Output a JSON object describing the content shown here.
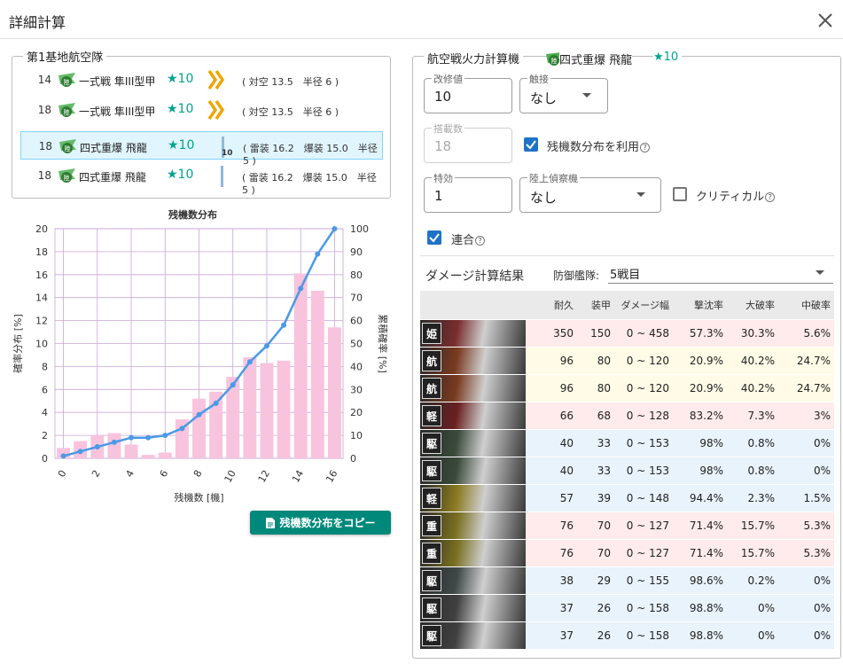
{
  "dialog": {
    "title": "詳細計算",
    "close_icon": "close-icon"
  },
  "air_base": {
    "legend": "第1基地航空隊",
    "slots": [
      {
        "count": "14",
        "name": "一式戦 隼III型甲",
        "star": "★10",
        "proficiency": "chevron",
        "stats": "( 対空 13.5　半径 6 )",
        "selected": false
      },
      {
        "count": "18",
        "name": "一式戦 隼III型甲",
        "star": "★10",
        "proficiency": "chevron",
        "stats": "( 対空 13.5　半径 6 )",
        "selected": false
      },
      {
        "count": "18",
        "name": "四式重爆 飛龍",
        "star": "★10",
        "proficiency": "bar",
        "level": "10",
        "stats": "( 雷装 16.2　爆装 15.0　半径 5 )",
        "selected": true
      },
      {
        "count": "18",
        "name": "四式重爆 飛龍",
        "star": "★10",
        "proficiency": "bar",
        "stats": "( 雷装 16.2　爆装 15.0　半径 5 )",
        "selected": false
      }
    ]
  },
  "chart_data": {
    "type": "bar",
    "title": "残機数分布",
    "xlabel": "残機数 [機]",
    "ylabel": "確率分布 [%]",
    "y2label": "累積確率 [%]",
    "ylim": [
      0,
      20
    ],
    "y2lim": [
      0,
      100
    ],
    "yticks": [
      "0",
      "2",
      "4",
      "6",
      "8",
      "10",
      "12",
      "14",
      "16",
      "18",
      "20"
    ],
    "y2ticks": [
      "0",
      "10",
      "20",
      "30",
      "40",
      "50",
      "60",
      "70",
      "80",
      "90",
      "100"
    ],
    "xticks": [
      "0",
      "2",
      "4",
      "6",
      "8",
      "10",
      "12",
      "14",
      "16"
    ],
    "categories": [
      0,
      1,
      2,
      3,
      4,
      5,
      6,
      7,
      8,
      9,
      10,
      11,
      12,
      13,
      14,
      15,
      16
    ],
    "series": [
      {
        "values": [
          0.9,
          1.5,
          2.0,
          2.2,
          1.2,
          0.3,
          0.5,
          3.4,
          5.2,
          5.8,
          7.1,
          8.8,
          8.3,
          8.5,
          16.1,
          14.6,
          11.4
        ],
        "color": "#f8c3dd"
      },
      {
        "values": [
          1,
          3,
          5,
          7,
          9,
          9,
          10,
          13,
          19,
          24,
          32,
          42,
          49,
          58,
          74,
          89,
          100
        ],
        "color": "#4a9ae6",
        "axis": "right"
      }
    ]
  },
  "copy_button": {
    "label": "残機数分布をコピー",
    "icon": "document-icon"
  },
  "calc": {
    "legend": "航空戦火力計算機",
    "equipment": "四式重爆 飛龍",
    "equipment_star": "★10",
    "fields": {
      "kaishu": {
        "label": "改修値",
        "value": "10"
      },
      "contact": {
        "label": "触接",
        "value": "なし"
      },
      "slots": {
        "label": "搭載数",
        "value": "18"
      },
      "special": {
        "label": "特効",
        "value": "1"
      },
      "recon": {
        "label": "陸上偵察機",
        "value": "なし"
      }
    },
    "use_distribution": "残機数分布を利用",
    "critical": "クリティカル",
    "combined": "連合"
  },
  "results": {
    "title": "ダメージ計算結果",
    "defense_label": "防御艦隊:",
    "defense_value": "5戦目",
    "headers": [
      "耐久",
      "装甲",
      "ダメージ幅",
      "撃沈率",
      "大破率",
      "中破率"
    ],
    "rows": [
      {
        "badge": "姫",
        "hp": "350",
        "armor": "150",
        "range": "0 ~ 458",
        "sink": "57.3%",
        "heavy": "30.3%",
        "mid": "5.6%",
        "color": "red",
        "tint": "#7a2d2d"
      },
      {
        "badge": "航",
        "hp": "96",
        "armor": "80",
        "range": "0 ~ 120",
        "sink": "20.9%",
        "heavy": "40.2%",
        "mid": "24.7%",
        "color": "yellow",
        "tint": "#7a3a20"
      },
      {
        "badge": "航",
        "hp": "96",
        "armor": "80",
        "range": "0 ~ 120",
        "sink": "20.9%",
        "heavy": "40.2%",
        "mid": "24.7%",
        "color": "yellow",
        "tint": "#7a3a20"
      },
      {
        "badge": "軽",
        "hp": "66",
        "armor": "68",
        "range": "0 ~ 128",
        "sink": "83.2%",
        "heavy": "7.3%",
        "mid": "3%",
        "color": "red",
        "tint": "#6a2020"
      },
      {
        "badge": "駆",
        "hp": "40",
        "armor": "33",
        "range": "0 ~ 153",
        "sink": "98%",
        "heavy": "0.8%",
        "mid": "0%",
        "color": "blue",
        "tint": "#3a4a3a"
      },
      {
        "badge": "駆",
        "hp": "40",
        "armor": "33",
        "range": "0 ~ 153",
        "sink": "98%",
        "heavy": "0.8%",
        "mid": "0%",
        "color": "blue",
        "tint": "#3a4a3a"
      },
      {
        "badge": "軽",
        "hp": "57",
        "armor": "39",
        "range": "0 ~ 148",
        "sink": "94.4%",
        "heavy": "2.3%",
        "mid": "1.5%",
        "color": "blue",
        "tint": "#8a7a20"
      },
      {
        "badge": "重",
        "hp": "76",
        "armor": "70",
        "range": "0 ~ 127",
        "sink": "71.4%",
        "heavy": "15.7%",
        "mid": "5.3%",
        "color": "red",
        "tint": "#7a7020"
      },
      {
        "badge": "重",
        "hp": "76",
        "armor": "70",
        "range": "0 ~ 127",
        "sink": "71.4%",
        "heavy": "15.7%",
        "mid": "5.3%",
        "color": "red",
        "tint": "#7a7020"
      },
      {
        "badge": "駆",
        "hp": "38",
        "armor": "29",
        "range": "0 ~ 155",
        "sink": "98.6%",
        "heavy": "0.2%",
        "mid": "0%",
        "color": "blue",
        "tint": "#404848"
      },
      {
        "badge": "駆",
        "hp": "37",
        "armor": "26",
        "range": "0 ~ 158",
        "sink": "98.8%",
        "heavy": "0%",
        "mid": "0%",
        "color": "blue",
        "tint": "#404040"
      },
      {
        "badge": "駆",
        "hp": "37",
        "armor": "26",
        "range": "0 ~ 158",
        "sink": "98.8%",
        "heavy": "0%",
        "mid": "0%",
        "color": "blue",
        "tint": "#404040"
      }
    ]
  }
}
